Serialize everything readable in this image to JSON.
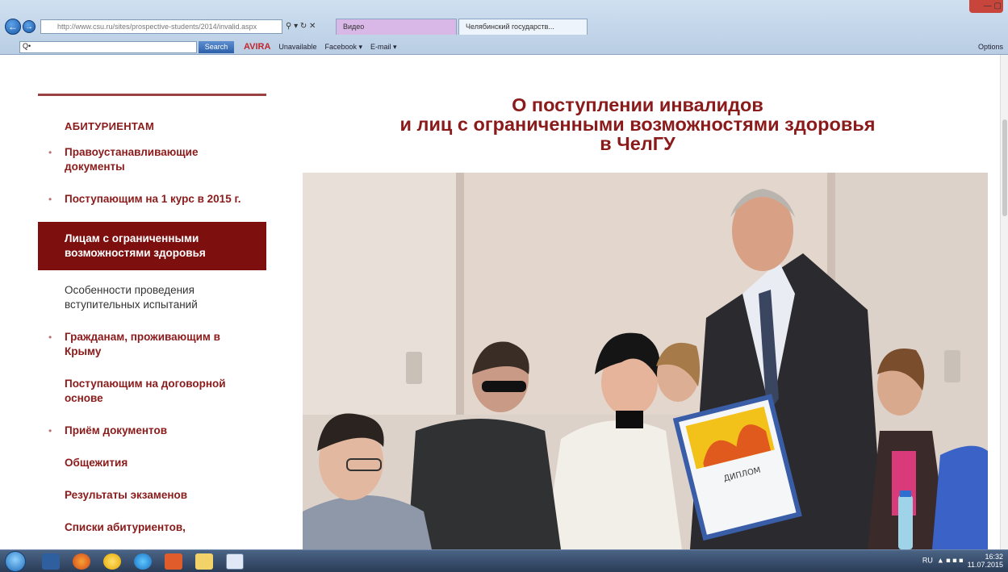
{
  "browser": {
    "address": "http://www.csu.ru/sites/prospective-students/2014/invalid.aspx",
    "tab1": "Видео",
    "tab2": "Челябинский государств...",
    "toolbar_search_placeholder": "Q•",
    "search_label": "Search",
    "avira_label": "AVIRA",
    "unavailable_label": "Unavailable",
    "facebook_label": "Facebook ▾",
    "email_label": "E-mail ▾",
    "options_label": "Options"
  },
  "sidebar": {
    "heading": "АБИТУРИЕНТАМ",
    "items": [
      {
        "label": "Правоустанавливающие документы"
      },
      {
        "label": "Поступающим на 1 курс в 2015 г."
      },
      {
        "label": "Лицам с ограниченными возможностями здоровья"
      },
      {
        "label": "Особенности проведения вступительных испытаний"
      },
      {
        "label": "Гражданам, проживающим в Крыму"
      },
      {
        "label": "Поступающим на договорной основе"
      },
      {
        "label": "Приём документов"
      },
      {
        "label": "Общежития"
      },
      {
        "label": "Результаты экзаменов"
      },
      {
        "label": "Списки абитуриентов,"
      }
    ],
    "bullet": "•"
  },
  "main": {
    "title_line1": "О поступлении инвалидов",
    "title_line2": "и лиц с ограниченными возможностями здоровья",
    "title_line3": "в ЧелГУ",
    "photo_caption_diploma": "ДИПЛОМ"
  },
  "taskbar": {
    "lang": "RU",
    "time": "16:32",
    "date": "11.07.2015"
  },
  "colors": {
    "accent": "#8b1a1a",
    "active_bg": "#7d0f0f"
  }
}
